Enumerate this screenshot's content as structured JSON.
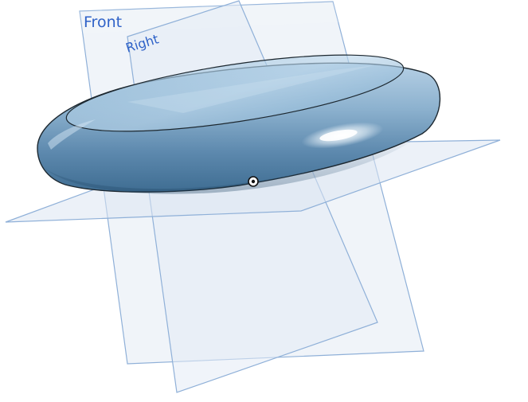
{
  "viewport": {
    "planes": {
      "front_label": "Front",
      "right_label": "Right",
      "top_label": ""
    },
    "model": {
      "part": "torus-ring"
    },
    "origin": {
      "icon": "origin-icon"
    }
  },
  "colors": {
    "plane_fill": "#dfe7f3",
    "plane_edge": "#8fb0d8",
    "label": "#2f62c8",
    "ring_light": "#b7d3e8",
    "ring_mid": "#84abc9",
    "ring_dark": "#4f7b9f",
    "ring_edge": "#1d2830",
    "highlight": "#ffffff"
  }
}
